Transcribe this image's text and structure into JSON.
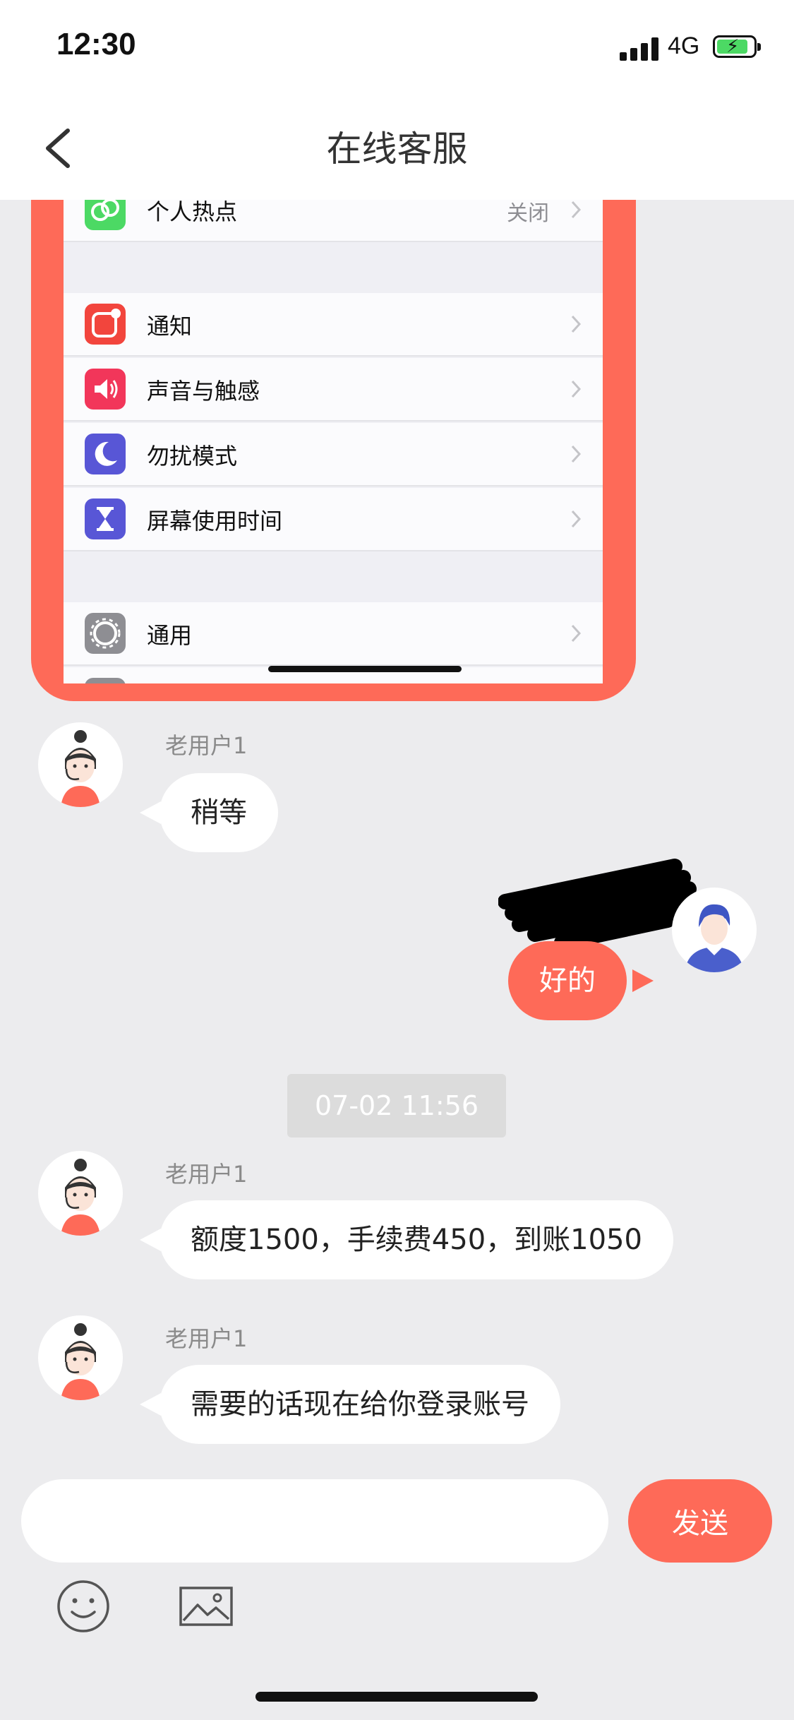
{
  "status_bar": {
    "time": "12:30",
    "network": "4G"
  },
  "nav": {
    "title": "在线客服",
    "back_icon": "chevron-left-icon"
  },
  "screenshot_bubble": {
    "rows": [
      {
        "label": "个人热点",
        "value": "关闭",
        "icon": "hotspot-icon",
        "color": "#4cd964"
      },
      {
        "label": "通知",
        "value": "",
        "icon": "notification-icon",
        "color": "#f2453d"
      },
      {
        "label": "声音与触感",
        "value": "",
        "icon": "sound-icon",
        "color": "#f2365a"
      },
      {
        "label": "勿扰模式",
        "value": "",
        "icon": "moon-icon",
        "color": "#5856d6"
      },
      {
        "label": "屏幕使用时间",
        "value": "",
        "icon": "hourglass-icon",
        "color": "#5856d6"
      },
      {
        "label": "通用",
        "value": "",
        "icon": "gear-icon",
        "color": "#8e8e93"
      }
    ]
  },
  "messages": [
    {
      "sender": "老用户1",
      "text": "稍等",
      "direction": "in"
    },
    {
      "text": "好的",
      "direction": "out"
    },
    {
      "timestamp": "07-02 11:56"
    },
    {
      "sender": "老用户1",
      "text": "额度1500，手续费450，到账1050",
      "direction": "in"
    },
    {
      "sender": "老用户1",
      "text": "需要的话现在给你登录账号",
      "direction": "in"
    }
  ],
  "composer": {
    "placeholder": "",
    "send_label": "发送"
  },
  "toolbar": {
    "emoji_icon": "smiley-icon",
    "image_icon": "image-icon"
  },
  "colors": {
    "accent": "#fe6a58",
    "background": "#ececee",
    "bubble_in": "#ffffff"
  }
}
